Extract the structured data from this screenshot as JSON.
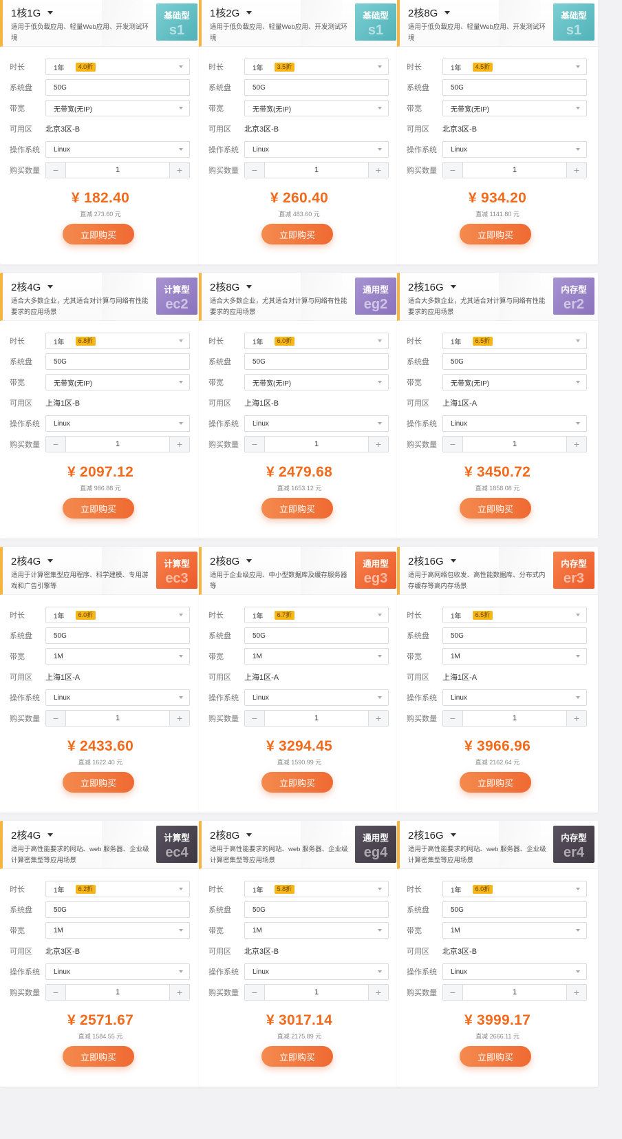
{
  "labels": {
    "duration": "时长",
    "disk": "系统盘",
    "bandwidth": "带宽",
    "zone": "可用区",
    "os": "操作系统",
    "quantity": "购买数量",
    "buy": "立即购买",
    "minus": "−",
    "plus": "+"
  },
  "cards": [
    {
      "spec": "1核1G",
      "desc": "适用于低负载应用、轻量Web应用、开发测试环境",
      "type": "基础型",
      "code": "s1",
      "badge_color": "teal",
      "duration": "1年",
      "discount": "4.0折",
      "disk": "50G",
      "bandwidth": "无带宽(无IP)",
      "zone": "北京3区-B",
      "os": "Linux",
      "quantity": "1",
      "price": "¥ 182.40",
      "saved": "直减 273.60 元"
    },
    {
      "spec": "1核2G",
      "desc": "适用于低负载应用、轻量Web应用、开发测试环境",
      "type": "基础型",
      "code": "s1",
      "badge_color": "teal",
      "duration": "1年",
      "discount": "3.5折",
      "disk": "50G",
      "bandwidth": "无带宽(无IP)",
      "zone": "北京3区-B",
      "os": "Linux",
      "quantity": "1",
      "price": "¥ 260.40",
      "saved": "直减 483.60 元"
    },
    {
      "spec": "2核8G",
      "desc": "适用于低负载应用、轻量Web应用、开发测试环境",
      "type": "基础型",
      "code": "s1",
      "badge_color": "teal",
      "duration": "1年",
      "discount": "4.5折",
      "disk": "50G",
      "bandwidth": "无带宽(无IP)",
      "zone": "北京3区-B",
      "os": "Linux",
      "quantity": "1",
      "price": "¥ 934.20",
      "saved": "直减 1141.80 元"
    },
    {
      "spec": "2核4G",
      "desc": "适合大多数企业，尤其适合对计算与网络有性能要求的应用场景",
      "type": "计算型",
      "code": "ec2",
      "badge_color": "purple",
      "duration": "1年",
      "discount": "6.8折",
      "disk": "50G",
      "bandwidth": "无带宽(无IP)",
      "zone": "上海1区-B",
      "os": "Linux",
      "quantity": "1",
      "price": "¥ 2097.12",
      "saved": "直减 986.88 元"
    },
    {
      "spec": "2核8G",
      "desc": "适合大多数企业，尤其适合对计算与网络有性能要求的应用场景",
      "type": "通用型",
      "code": "eg2",
      "badge_color": "purple",
      "duration": "1年",
      "discount": "6.0折",
      "disk": "50G",
      "bandwidth": "无带宽(无IP)",
      "zone": "上海1区-B",
      "os": "Linux",
      "quantity": "1",
      "price": "¥ 2479.68",
      "saved": "直减 1653.12 元"
    },
    {
      "spec": "2核16G",
      "desc": "适合大多数企业，尤其适合对计算与网络有性能要求的应用场景",
      "type": "内存型",
      "code": "er2",
      "badge_color": "purple",
      "duration": "1年",
      "discount": "6.5折",
      "disk": "50G",
      "bandwidth": "无带宽(无IP)",
      "zone": "上海1区-A",
      "os": "Linux",
      "quantity": "1",
      "price": "¥ 3450.72",
      "saved": "直减 1858.08 元"
    },
    {
      "spec": "2核4G",
      "desc": "适用于计算密集型应用程序、科学建模、专用游戏和广告引擎等",
      "type": "计算型",
      "code": "ec3",
      "badge_color": "orange",
      "duration": "1年",
      "discount": "6.0折",
      "disk": "50G",
      "bandwidth": "1M",
      "zone": "上海1区-A",
      "os": "Linux",
      "quantity": "1",
      "price": "¥ 2433.60",
      "saved": "直减 1622.40 元"
    },
    {
      "spec": "2核8G",
      "desc": "适用于企业级应用、中小型数据库及缓存服务器等",
      "type": "通用型",
      "code": "eg3",
      "badge_color": "orange",
      "duration": "1年",
      "discount": "6.7折",
      "disk": "50G",
      "bandwidth": "1M",
      "zone": "上海1区-A",
      "os": "Linux",
      "quantity": "1",
      "price": "¥ 3294.45",
      "saved": "直减 1590.99 元"
    },
    {
      "spec": "2核16G",
      "desc": "适用于高网络包收发、高性能数据库、分布式内存缓存等高内存场景",
      "type": "内存型",
      "code": "er3",
      "badge_color": "orange",
      "duration": "1年",
      "discount": "6.5折",
      "disk": "50G",
      "bandwidth": "1M",
      "zone": "上海1区-A",
      "os": "Linux",
      "quantity": "1",
      "price": "¥ 3966.96",
      "saved": "直减 2162.64 元"
    },
    {
      "spec": "2核4G",
      "desc": "适用于高性能要求的网站、web 服务器、企业级计算密集型等应用场景",
      "type": "计算型",
      "code": "ec4",
      "badge_color": "dark",
      "duration": "1年",
      "discount": "6.2折",
      "disk": "50G",
      "bandwidth": "1M",
      "zone": "北京3区-B",
      "os": "Linux",
      "quantity": "1",
      "price": "¥ 2571.67",
      "saved": "直减 1584.55 元"
    },
    {
      "spec": "2核8G",
      "desc": "适用于高性能要求的网站、web 服务器、企业级计算密集型等应用场景",
      "type": "通用型",
      "code": "eg4",
      "badge_color": "dark",
      "duration": "1年",
      "discount": "5.8折",
      "disk": "50G",
      "bandwidth": "1M",
      "zone": "北京3区-B",
      "os": "Linux",
      "quantity": "1",
      "price": "¥ 3017.14",
      "saved": "直减 2175.89 元"
    },
    {
      "spec": "2核16G",
      "desc": "适用于高性能要求的网站、web 服务器、企业级计算密集型等应用场景",
      "type": "内存型",
      "code": "er4",
      "badge_color": "dark",
      "duration": "1年",
      "discount": "6.0折",
      "disk": "50G",
      "bandwidth": "1M",
      "zone": "北京3区-B",
      "os": "Linux",
      "quantity": "1",
      "price": "¥ 3999.17",
      "saved": "直减 2666.11 元"
    }
  ]
}
